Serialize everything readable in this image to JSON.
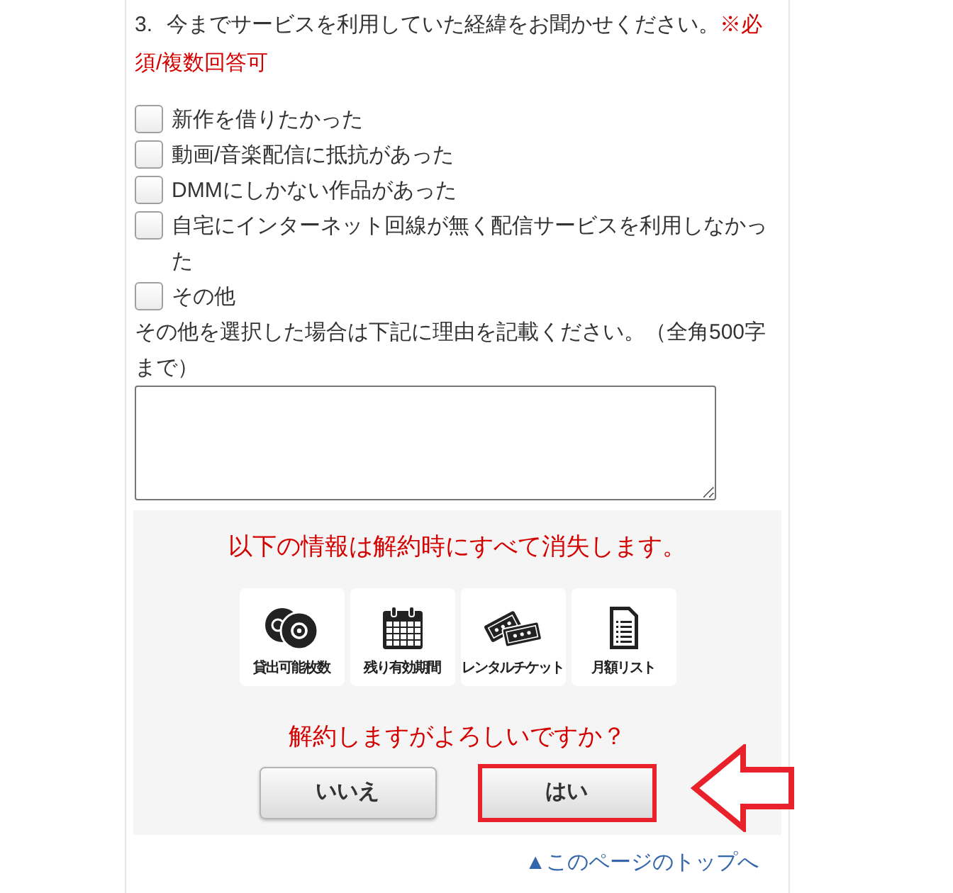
{
  "question": {
    "number": "3.",
    "text": "今までサービスを利用していた経緯をお聞かせください。",
    "note": "※必須/複数回答可"
  },
  "options": [
    {
      "label": "新作を借りたかった",
      "checked": false
    },
    {
      "label": "動画/音楽配信に抵抗があった",
      "checked": false
    },
    {
      "label": "DMMにしかない作品があった",
      "checked": false
    },
    {
      "label": "自宅にインターネット回線が無く配信サービスを利用しなかった",
      "checked": false
    },
    {
      "label": "その他",
      "checked": false
    }
  ],
  "other_note": "その他を選択した場合は下記に理由を記載ください。（全角500字まで）",
  "warning": {
    "heading": "以下の情報は解約時にすべて消失します。",
    "items": [
      {
        "kind": "discs",
        "label": "貸出可能枚数"
      },
      {
        "kind": "calendar",
        "label": "残り有効期間"
      },
      {
        "kind": "tickets",
        "label": "レンタルチケット"
      },
      {
        "kind": "document",
        "label": "月額リスト"
      }
    ],
    "confirm": "解約しますがよろしいですか？",
    "buttons": [
      {
        "label": "いいえ",
        "highlighted": false
      },
      {
        "label": "はい",
        "highlighted": true
      }
    ]
  },
  "page_top_link": "▲このページのトップへ"
}
